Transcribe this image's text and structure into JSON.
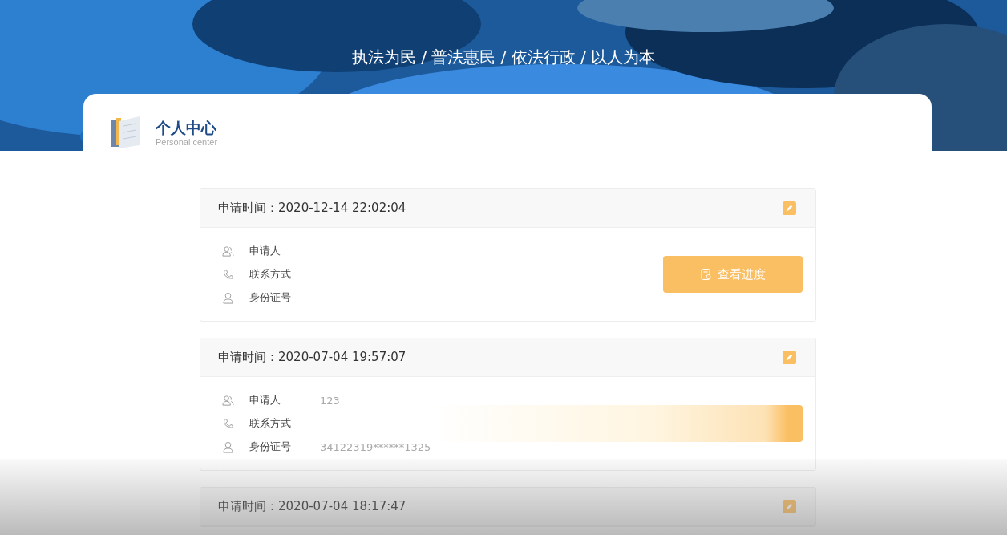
{
  "banner": {
    "slogan": "执法为民 / 普法惠民 / 依法行政 / 以人为本"
  },
  "panel": {
    "title": "个人中心",
    "subtitle": "Personal center"
  },
  "cards": [
    {
      "time_label": "申请时间：",
      "time": "2020-12-14 22:02:04",
      "fields": [
        {
          "kind": "person",
          "label": "申请人"
        },
        {
          "kind": "phone",
          "label": "联系方式"
        },
        {
          "kind": "id",
          "label": "身份证号"
        }
      ],
      "button": {
        "label": "查看进度"
      }
    },
    {
      "time_label": "申请时间：",
      "time": "2020-07-04 19:57:07",
      "fields": [
        {
          "kind": "person",
          "label": "申请人",
          "value": "123"
        },
        {
          "kind": "phone",
          "label": "联系方式"
        },
        {
          "kind": "id",
          "label": "身份证号",
          "value": "34122319******1325"
        }
      ],
      "button": {
        "faded": true
      }
    },
    {
      "time_label": "申请时间：",
      "time": "2020-07-04 18:17:47"
    }
  ]
}
